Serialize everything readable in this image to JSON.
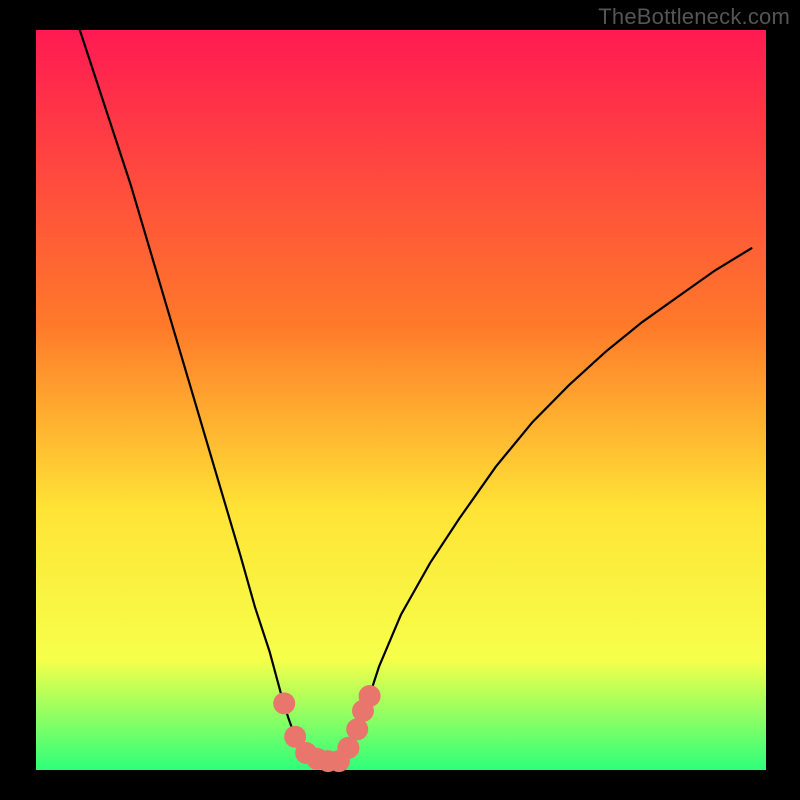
{
  "watermark": "TheBottleneck.com",
  "colors": {
    "background": "#000000",
    "gradient_top": "#ff1a52",
    "gradient_mid1": "#ff7a2a",
    "gradient_mid2": "#ffe436",
    "gradient_mid3": "#f6ff4a",
    "gradient_bottom": "#2eff7a",
    "curve_stroke": "#000000",
    "marker_fill": "#e9766d"
  },
  "chart_data": {
    "type": "line",
    "title": "",
    "xlabel": "",
    "ylabel": "",
    "xlim": [
      0,
      1
    ],
    "ylim": [
      0,
      1
    ],
    "curve": [
      {
        "x": 0.06,
        "y": 1.0
      },
      {
        "x": 0.08,
        "y": 0.94
      },
      {
        "x": 0.1,
        "y": 0.88
      },
      {
        "x": 0.13,
        "y": 0.79
      },
      {
        "x": 0.16,
        "y": 0.69
      },
      {
        "x": 0.19,
        "y": 0.59
      },
      {
        "x": 0.22,
        "y": 0.49
      },
      {
        "x": 0.25,
        "y": 0.39
      },
      {
        "x": 0.28,
        "y": 0.29
      },
      {
        "x": 0.3,
        "y": 0.22
      },
      {
        "x": 0.32,
        "y": 0.16
      },
      {
        "x": 0.335,
        "y": 0.105
      },
      {
        "x": 0.345,
        "y": 0.072
      },
      {
        "x": 0.355,
        "y": 0.045
      },
      {
        "x": 0.365,
        "y": 0.028
      },
      {
        "x": 0.375,
        "y": 0.018
      },
      {
        "x": 0.385,
        "y": 0.013
      },
      {
        "x": 0.395,
        "y": 0.012
      },
      {
        "x": 0.405,
        "y": 0.012
      },
      {
        "x": 0.415,
        "y": 0.012
      },
      {
        "x": 0.425,
        "y": 0.02
      },
      {
        "x": 0.435,
        "y": 0.04
      },
      {
        "x": 0.445,
        "y": 0.067
      },
      {
        "x": 0.455,
        "y": 0.095
      },
      {
        "x": 0.47,
        "y": 0.14
      },
      {
        "x": 0.5,
        "y": 0.21
      },
      {
        "x": 0.54,
        "y": 0.28
      },
      {
        "x": 0.58,
        "y": 0.34
      },
      {
        "x": 0.63,
        "y": 0.41
      },
      {
        "x": 0.68,
        "y": 0.47
      },
      {
        "x": 0.73,
        "y": 0.52
      },
      {
        "x": 0.78,
        "y": 0.565
      },
      {
        "x": 0.83,
        "y": 0.605
      },
      {
        "x": 0.88,
        "y": 0.64
      },
      {
        "x": 0.93,
        "y": 0.675
      },
      {
        "x": 0.98,
        "y": 0.705
      }
    ],
    "markers": [
      {
        "x": 0.34,
        "y": 0.09
      },
      {
        "x": 0.355,
        "y": 0.045
      },
      {
        "x": 0.37,
        "y": 0.023
      },
      {
        "x": 0.385,
        "y": 0.015
      },
      {
        "x": 0.4,
        "y": 0.012
      },
      {
        "x": 0.415,
        "y": 0.012
      },
      {
        "x": 0.428,
        "y": 0.03
      },
      {
        "x": 0.44,
        "y": 0.055
      },
      {
        "x": 0.448,
        "y": 0.08
      },
      {
        "x": 0.457,
        "y": 0.1
      }
    ]
  }
}
